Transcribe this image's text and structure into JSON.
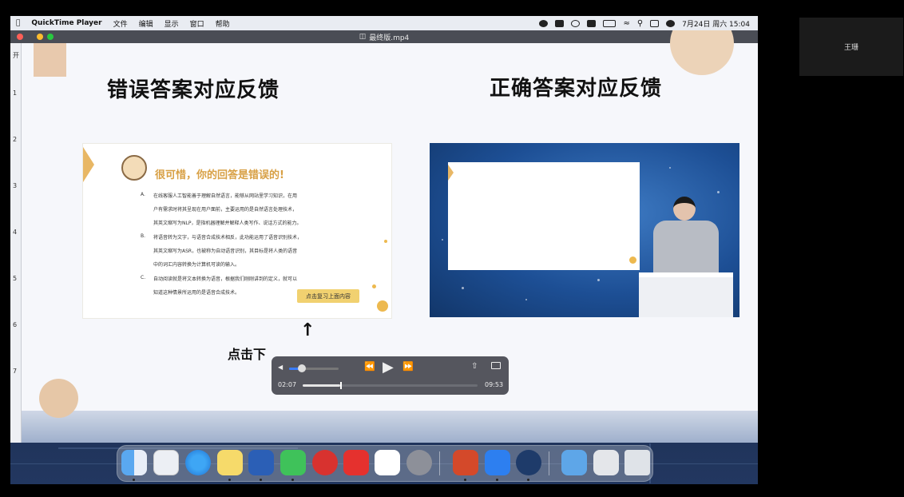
{
  "menubar": {
    "app_name": "QuickTime Player",
    "menus": [
      "文件",
      "编辑",
      "显示",
      "窗口",
      "帮助"
    ],
    "clock": "7月24日 周六 15:04"
  },
  "window": {
    "title": "最终版.mp4"
  },
  "left_strip": {
    "items": [
      "开",
      "1",
      "2",
      "3",
      "4",
      "5",
      "6",
      "7"
    ]
  },
  "slide": {
    "heading_wrong": "错误答案对应反馈",
    "heading_correct": "正确答案对应反馈",
    "wrong_message": "很可惜，你的回答是错误的!",
    "options": [
      {
        "letter": "A.",
        "lines": [
          "在线客服人工智能善于理解自然语言，能够从网站里学习知识，在用",
          "户有需求时将其呈现在用户面前，主要运用的是自然语言处理技术，",
          "其英文缩写为NLP，是指机器理解并解释人类写作、说话方式的能力。"
        ]
      },
      {
        "letter": "B.",
        "lines": [
          "将语音转为文字，与语音合成技术相反，此功能运用了语音识别技术，",
          "其英文缩写为ASR，也被称为自动语音识别，其目标是将人类的语音",
          "中的词汇内容转换为计算机可读的输入。"
        ]
      },
      {
        "letter": "C.",
        "lines": [
          "自动阅读就是将文本转换为语音，根据我们刚刚讲到的定义，就可以",
          "知道这种情景所运用的是语音合成技术。"
        ]
      }
    ],
    "review_button": "点击复习上面内容",
    "click_text": "点击下"
  },
  "player": {
    "current_time": "02:07",
    "total_time": "09:53",
    "progress": 0.216,
    "volume": 0.25
  },
  "participant": {
    "name": "王珊"
  },
  "colors": {
    "gold": "#d8a045",
    "accent_blue": "#3a7dff"
  },
  "dock": {
    "apps": [
      "finder-icon",
      "launchpad-icon",
      "safari-icon",
      "notes-icon",
      "word-icon",
      "wechat-icon",
      "netease-music-icon",
      "youdao-icon",
      "baidu-netdisk-icon",
      "system-preferences-icon",
      "powerpoint-icon",
      "tencent-meeting-icon",
      "quicktime-icon",
      "folder-icon",
      "keyboard-viewer-icon",
      "trash-icon"
    ]
  }
}
